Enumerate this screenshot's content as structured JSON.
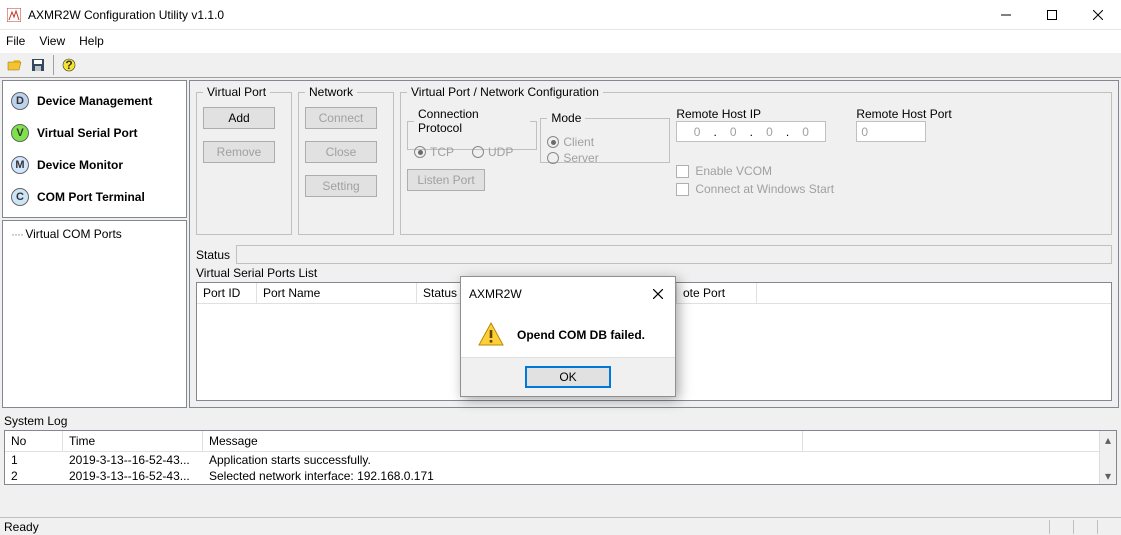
{
  "window": {
    "title": "AXMR2W Configuration Utility v1.1.0",
    "min": "—",
    "max": "☐",
    "close": "✕"
  },
  "menu": {
    "file": "File",
    "view": "View",
    "help": "Help"
  },
  "nav": {
    "device_mgmt": "Device Management",
    "virtual_serial": "Virtual Serial Port",
    "device_monitor": "Device Monitor",
    "com_terminal": "COM Port Terminal"
  },
  "tree": {
    "root": "Virtual COM Ports"
  },
  "groups": {
    "virtual_port": "Virtual Port",
    "network": "Network",
    "vpnc": "Virtual Port / Network Configuration",
    "conn_proto": "Connection Protocol",
    "mode": "Mode",
    "remote_ip": "Remote Host IP",
    "remote_port": "Remote Host Port"
  },
  "buttons": {
    "add": "Add",
    "remove": "Remove",
    "connect": "Connect",
    "close": "Close",
    "setting": "Setting",
    "listen": "Listen Port"
  },
  "radios": {
    "tcp": "TCP",
    "udp": "UDP",
    "client": "Client",
    "server": "Server"
  },
  "checks": {
    "enable_vcom": "Enable VCOM",
    "conn_start": "Connect at Windows Start"
  },
  "ip": {
    "a": "0",
    "b": "0",
    "c": "0",
    "d": "0"
  },
  "port": "0",
  "status": {
    "label": "Status"
  },
  "list": {
    "label": "Virtual Serial Ports List",
    "cols": {
      "port_id": "Port ID",
      "port_name": "Port Name",
      "status": "Status",
      "remote_port": "ote Port"
    }
  },
  "syslog": {
    "title": "System Log",
    "cols": {
      "no": "No",
      "time": "Time",
      "msg": "Message"
    },
    "rows": [
      {
        "no": "1",
        "time": "2019-3-13--16-52-43...",
        "msg": "Application starts successfully."
      },
      {
        "no": "2",
        "time": "2019-3-13--16-52-43...",
        "msg": "Selected network interface: 192.168.0.171"
      }
    ]
  },
  "statusbar": {
    "ready": "Ready"
  },
  "dialog": {
    "title": "AXMR2W",
    "message": "Opend COM DB failed.",
    "ok": "OK"
  }
}
